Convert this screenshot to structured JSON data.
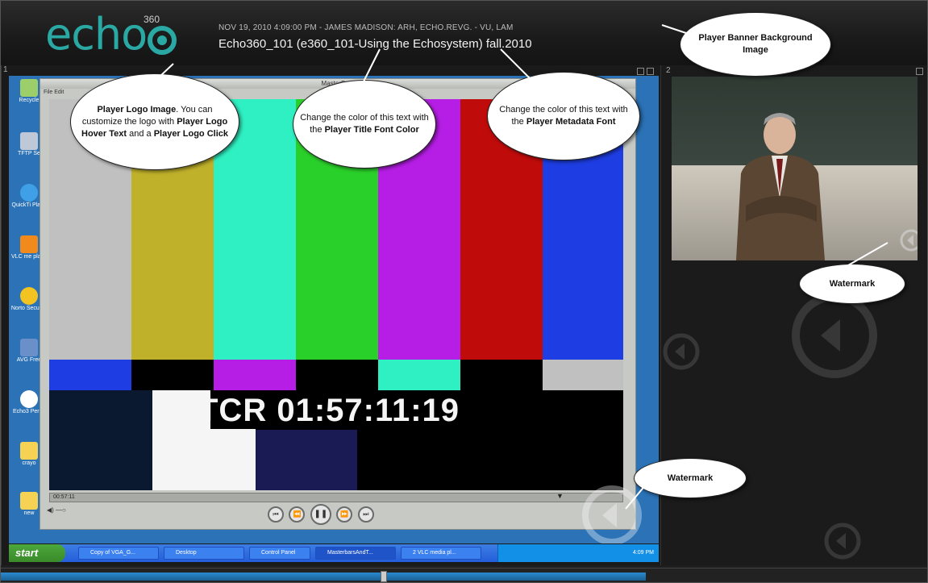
{
  "banner": {
    "logo_text": "echo",
    "logo_number": "360",
    "metadata": "NOV 19, 2010 4:09:00 PM - JAMES MADISON: ARH, ECHO.REVG. - VU, LAM",
    "title": "Echo360_101 (e360_101-Using the Echosystem) fall.2010"
  },
  "panels": {
    "left_number": "1",
    "right_number": "2"
  },
  "desktop": {
    "icons": [
      {
        "label": "Recycle",
        "icon": "recycle-bin-icon"
      },
      {
        "label": "TFTP Se",
        "icon": "network-icon"
      },
      {
        "label": "QuickTi Playe",
        "icon": "quicktime-icon"
      },
      {
        "label": "VLC me playe",
        "icon": "vlc-icon"
      },
      {
        "label": "Norto Security",
        "icon": "norton-icon"
      },
      {
        "label": "AVG Free",
        "icon": "avg-icon"
      },
      {
        "label": "Echo3 Perso",
        "icon": "echo-icon"
      },
      {
        "label": "crayo",
        "icon": "folder-icon"
      },
      {
        "label": "new",
        "icon": "folder-icon"
      }
    ]
  },
  "media": {
    "window_title": "MasterBars",
    "menu": "File  Edit",
    "timecode": "TCR 01:57:11:19",
    "seek_time": "00:57:11",
    "volume_icon": "speaker-icon"
  },
  "taskbar": {
    "start": "start",
    "tasks": [
      "Copy of VGA_G...",
      "Desktop",
      "Control Panel",
      "MasterbarsAndT...",
      "2 VLC media pl..."
    ],
    "clock": "4:09 PM"
  },
  "callouts": {
    "logo": {
      "line1": "Player Logo Image",
      "line2": ". You can customize the logo with ",
      "bold1": "Player Logo Hover Text",
      "line3": " and a ",
      "bold2": "Player Logo Click"
    },
    "title_color": {
      "text": "Change the color of this text with the ",
      "bold": "Player Title Font Color"
    },
    "metadata_color": {
      "text": "Change the color of this text with the ",
      "bold": "Player Metadata Font"
    },
    "banner_bg": {
      "bold": "Player Banner Background Image"
    },
    "watermark_top": {
      "bold": "Watermark"
    },
    "watermark_bottom": {
      "bold": "Watermark"
    }
  },
  "colors": {
    "accent": "#2aa9a4",
    "banner": "#1a1a1a"
  }
}
